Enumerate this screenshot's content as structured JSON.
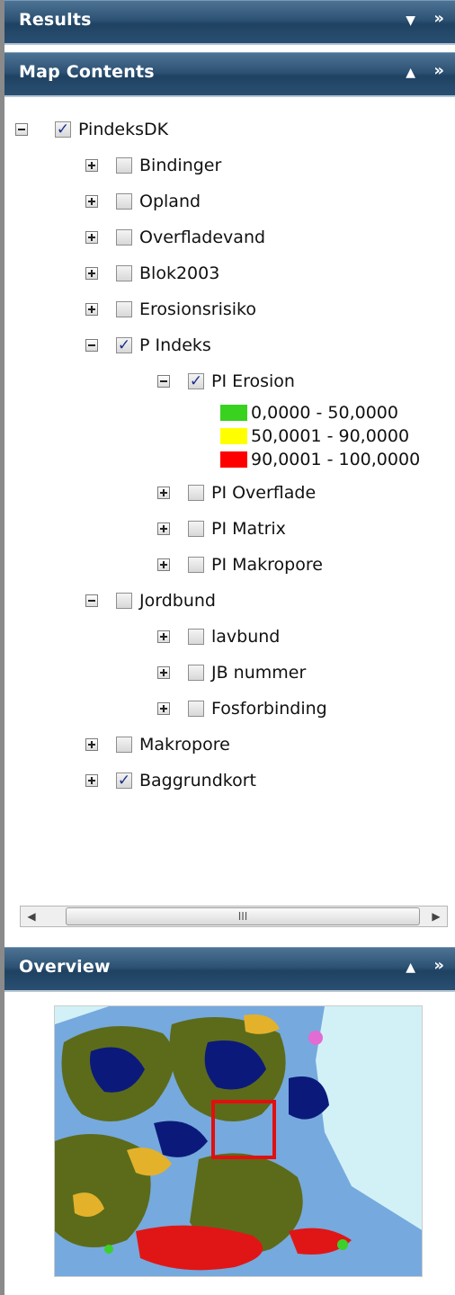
{
  "colors": {
    "header_gradient_top": "#4d7394",
    "header_gradient_bottom": "#1f4262",
    "legend_low": "#39d21f",
    "legend_mid": "#ffff00",
    "legend_high": "#ff0000",
    "extent_box": "#e01010"
  },
  "panels": {
    "results": {
      "title": "Results",
      "collapse_icon": "triangle-down-icon",
      "dock_icon": "double-chevron-right-icon"
    },
    "map_contents": {
      "title": "Map Contents",
      "collapse_icon": "triangle-up-icon",
      "dock_icon": "double-chevron-right-icon"
    },
    "overview": {
      "title": "Overview",
      "collapse_icon": "triangle-up-icon",
      "dock_icon": "double-chevron-right-icon"
    }
  },
  "tree": {
    "root": {
      "label": "PindeksDK",
      "checked": true,
      "expanded": true
    },
    "layers": [
      {
        "label": "Bindinger",
        "checked": false,
        "expanded": false
      },
      {
        "label": "Opland",
        "checked": false,
        "expanded": false
      },
      {
        "label": "Overfladevand",
        "checked": false,
        "expanded": false
      },
      {
        "label": "Blok2003",
        "checked": false,
        "expanded": false
      },
      {
        "label": "Erosionsrisiko",
        "checked": false,
        "expanded": false
      },
      {
        "label": "P Indeks",
        "checked": true,
        "expanded": true
      },
      {
        "label": "PI Erosion",
        "checked": true,
        "expanded": true
      },
      {
        "label": "PI Overflade",
        "checked": false,
        "expanded": false
      },
      {
        "label": "PI Matrix",
        "checked": false,
        "expanded": false
      },
      {
        "label": "PI Makropore",
        "checked": false,
        "expanded": false
      },
      {
        "label": "Jordbund",
        "checked": false,
        "expanded": true
      },
      {
        "label": "lavbund",
        "checked": false,
        "expanded": false
      },
      {
        "label": "JB nummer",
        "checked": false,
        "expanded": false
      },
      {
        "label": "Fosforbinding",
        "checked": false,
        "expanded": false
      },
      {
        "label": "Makropore",
        "checked": false,
        "expanded": false
      },
      {
        "label": "Baggrundkort",
        "checked": true,
        "expanded": false
      }
    ],
    "legend": [
      {
        "label": "0,0000 - 50,0000",
        "color": "#39d21f"
      },
      {
        "label": "50,0001 - 90,0000",
        "color": "#ffff00"
      },
      {
        "label": "90,0001 - 100,0000",
        "color": "#ff0000"
      }
    ]
  },
  "scrollbar": {
    "grip": "III"
  },
  "overview_map": {
    "label": "Overview map"
  }
}
